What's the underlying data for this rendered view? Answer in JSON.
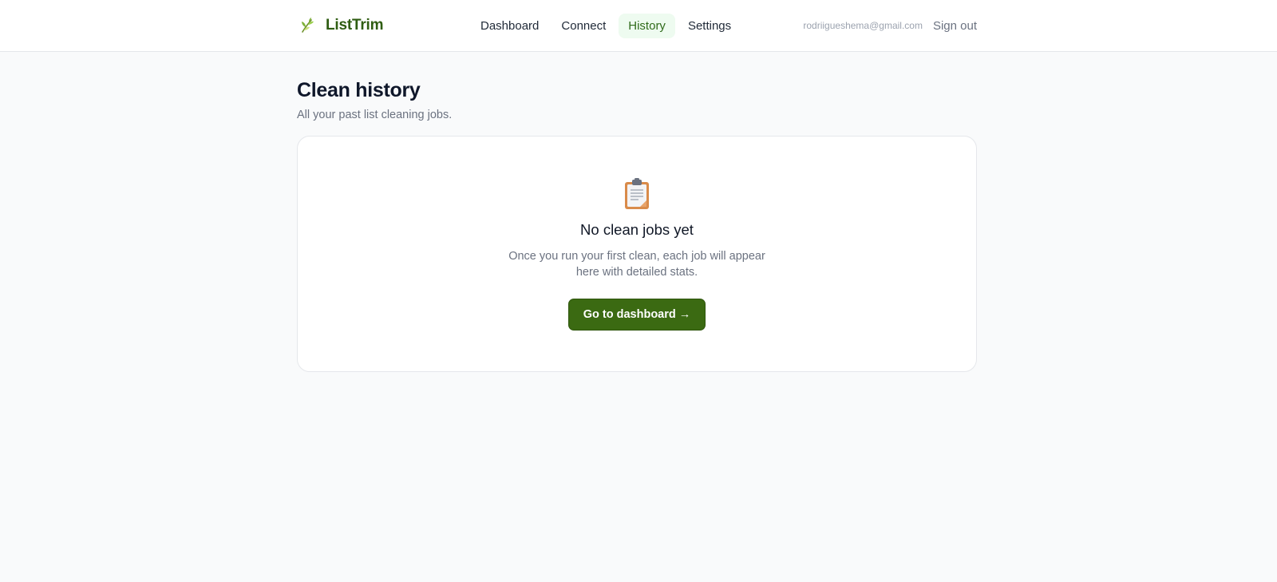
{
  "brand": {
    "name": "ListTrim",
    "icon": "leaf-sprout-icon",
    "color": "#2f5d12"
  },
  "nav": {
    "items": [
      {
        "label": "Dashboard",
        "active": false
      },
      {
        "label": "Connect",
        "active": false
      },
      {
        "label": "History",
        "active": true
      },
      {
        "label": "Settings",
        "active": false
      }
    ]
  },
  "user": {
    "email": "rodriigueshema@gmail.com",
    "signout_label": "Sign out"
  },
  "page": {
    "title": "Clean history",
    "subtitle": "All your past list cleaning jobs."
  },
  "empty_state": {
    "icon": "clipboard-icon",
    "title": "No clean jobs yet",
    "description": "Once you run your first clean, each job will appear here with detailed stats.",
    "button_label": "Go to dashboard →"
  },
  "colors": {
    "accent": "#3b6a12",
    "active_tab_bg": "#eefbf0",
    "active_tab_text": "#2f6b1a",
    "page_bg": "#f9fafb"
  }
}
